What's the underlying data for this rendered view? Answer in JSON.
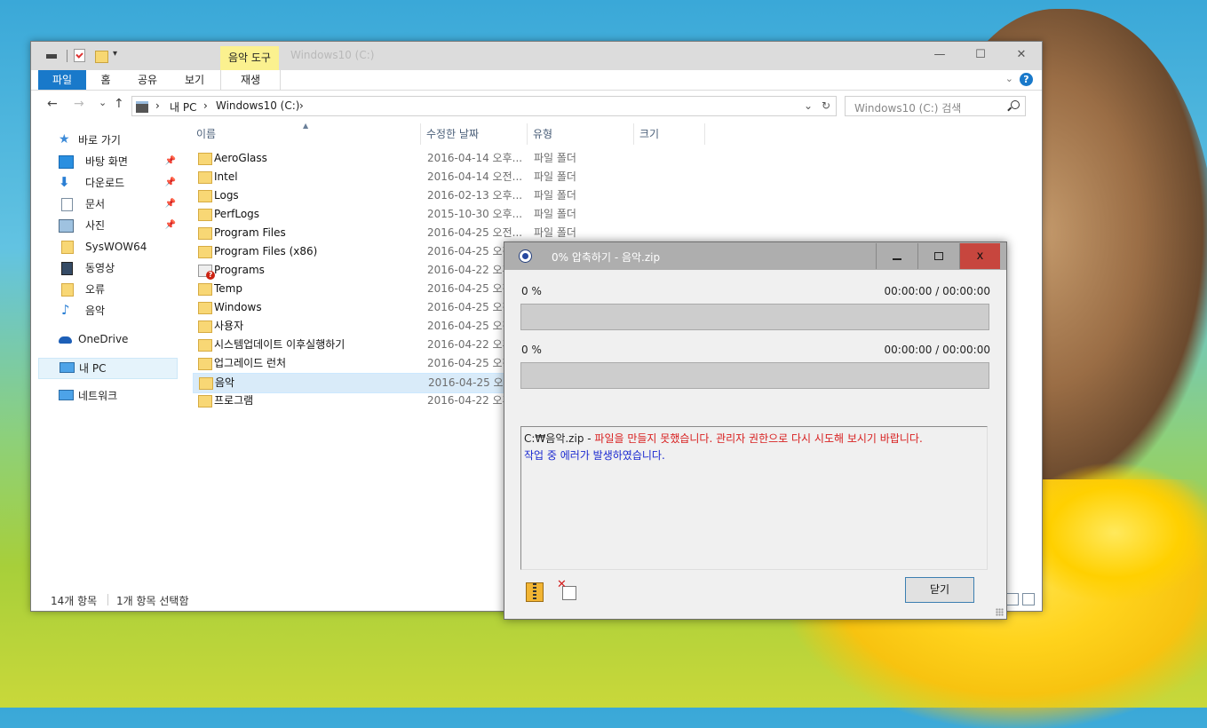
{
  "explorer": {
    "title": "Windows10 (C:)",
    "contextual_tab": "음악 도구",
    "ribbon_tabs": [
      "파일",
      "홈",
      "공유",
      "보기"
    ],
    "play_tab": "재생",
    "window_controls": {
      "minimize": "—",
      "maximize": "☐",
      "close": "✕"
    },
    "nav": {
      "back": "←",
      "forward": "→",
      "recent": "⌄",
      "up": "↑"
    },
    "address": {
      "crumb1": "내 PC",
      "crumb2": "Windows10 (C:)",
      "sep": "›",
      "dropdown": "⌄",
      "refresh": "↻"
    },
    "search_placeholder": "Windows10 (C:) 검색",
    "sidebar": {
      "quick_access": "바로 가기",
      "items": [
        {
          "label": "바탕 화면",
          "icon": "desktop-icon",
          "pinned": true
        },
        {
          "label": "다운로드",
          "icon": "download-icon",
          "pinned": true
        },
        {
          "label": "문서",
          "icon": "document-icon",
          "pinned": true
        },
        {
          "label": "사진",
          "icon": "pictures-icon",
          "pinned": true
        },
        {
          "label": "SysWOW64",
          "icon": "folder-icon",
          "pinned": false
        },
        {
          "label": "동영상",
          "icon": "video-icon",
          "pinned": false
        },
        {
          "label": "오류",
          "icon": "folder-icon",
          "pinned": false
        },
        {
          "label": "음악",
          "icon": "music-icon",
          "pinned": false
        }
      ],
      "onedrive": "OneDrive",
      "this_pc": "내 PC",
      "network": "네트워크"
    },
    "columns": {
      "name": "이름",
      "date": "수정한 날짜",
      "type": "유형",
      "size": "크기"
    },
    "files": [
      {
        "name": "AeroGlass",
        "date": "2016-04-14 오후...",
        "type": "파일 폴더"
      },
      {
        "name": "Intel",
        "date": "2016-04-14 오전...",
        "type": "파일 폴더"
      },
      {
        "name": "Logs",
        "date": "2016-02-13 오후...",
        "type": "파일 폴더"
      },
      {
        "name": "PerfLogs",
        "date": "2015-10-30 오후...",
        "type": "파일 폴더"
      },
      {
        "name": "Program Files",
        "date": "2016-04-25 오전...",
        "type": "파일 폴더"
      },
      {
        "name": "Program Files (x86)",
        "date": "2016-04-25 오전...",
        "type": ""
      },
      {
        "name": "Programs",
        "date": "2016-04-22 오후...",
        "type": ""
      },
      {
        "name": "Temp",
        "date": "2016-04-25 오전...",
        "type": ""
      },
      {
        "name": "Windows",
        "date": "2016-04-25 오전...",
        "type": ""
      },
      {
        "name": "사용자",
        "date": "2016-04-25 오전...",
        "type": ""
      },
      {
        "name": "시스템업데이트 이후실행하기",
        "date": "2016-04-22 오후...",
        "type": ""
      },
      {
        "name": "업그레이드 런처",
        "date": "2016-04-25 오전...",
        "type": ""
      },
      {
        "name": "음악",
        "date": "2016-04-25 오전...",
        "type": ""
      },
      {
        "name": "프로그램",
        "date": "2016-04-22 오후...",
        "type": ""
      }
    ],
    "status": {
      "count": "14개 항목",
      "selected": "1개 항목 선택함"
    }
  },
  "dialog": {
    "title": "0% 압축하기 - 음악.zip",
    "controls": {
      "close": "x"
    },
    "progress1": {
      "label": "0 %",
      "time": "00:00:00 / 00:00:00",
      "value": 0
    },
    "progress2": {
      "label": "0 %",
      "time": "00:00:00 / 00:00:00",
      "value": 0
    },
    "log": {
      "path": "C:₩음악.zip - ",
      "error": "파일을 만들지 못했습니다. 관리자 권한으로 다시 시도해 보시기 바랍니다.",
      "info": "작업 중 에러가 발생하였습니다."
    },
    "close_button": "닫기"
  },
  "colors": {
    "accent": "#1979ca",
    "contextual_tab": "#fbf18f",
    "dialog_titlebar": "#aeaeae",
    "close_red": "#c7463e",
    "error_text": "#d82020",
    "info_text": "#1c2ad0"
  }
}
